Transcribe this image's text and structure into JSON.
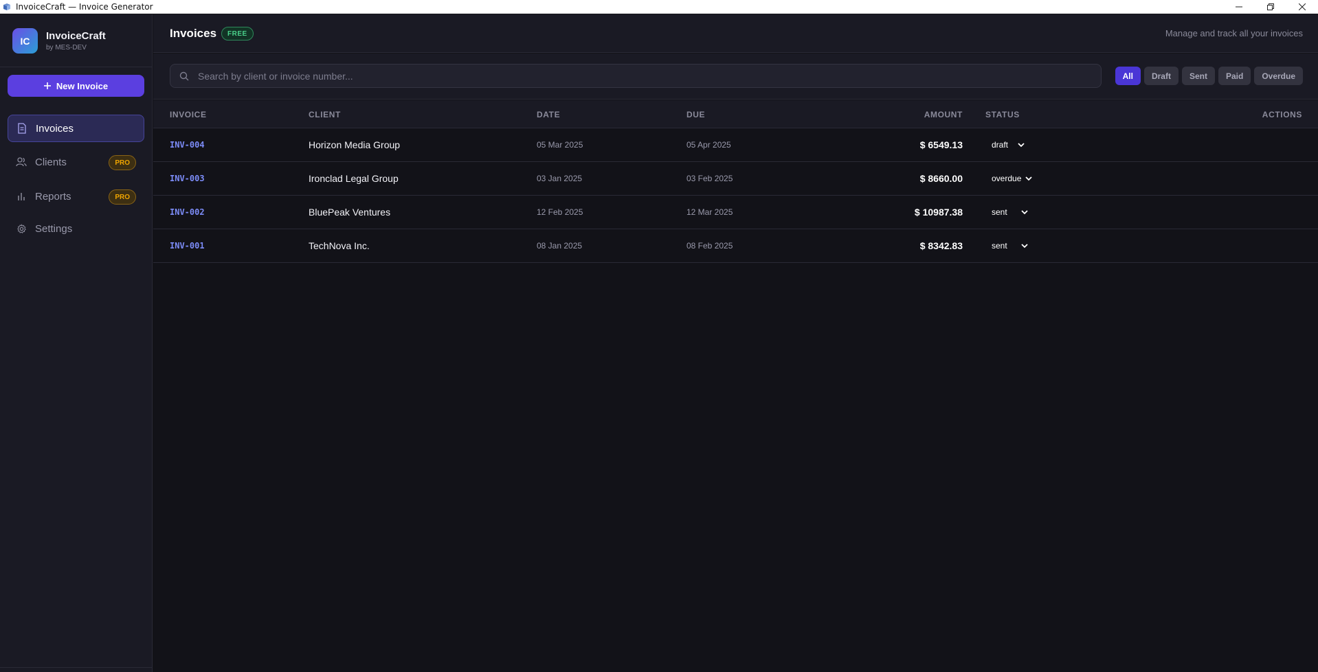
{
  "window": {
    "title": "InvoiceCraft — Invoice Generator"
  },
  "brand": {
    "initials": "IC",
    "name": "InvoiceCraft",
    "by": "by MES-DEV"
  },
  "sidebar": {
    "new_invoice_label": "New Invoice",
    "items": [
      {
        "label": "Invoices",
        "icon": "document-icon",
        "active": true,
        "badge": ""
      },
      {
        "label": "Clients",
        "icon": "users-icon",
        "active": false,
        "badge": "PRO"
      },
      {
        "label": "Reports",
        "icon": "bar-chart-icon",
        "active": false,
        "badge": "PRO"
      },
      {
        "label": "Settings",
        "icon": "gear-icon",
        "active": false,
        "badge": ""
      }
    ]
  },
  "header": {
    "title": "Invoices",
    "plan_badge": "FREE",
    "subtitle": "Manage and track all your invoices"
  },
  "search": {
    "placeholder": "Search by client or invoice number...",
    "value": ""
  },
  "filters": [
    {
      "label": "All",
      "active": true
    },
    {
      "label": "Draft",
      "active": false
    },
    {
      "label": "Sent",
      "active": false
    },
    {
      "label": "Paid",
      "active": false
    },
    {
      "label": "Overdue",
      "active": false
    }
  ],
  "table": {
    "columns": {
      "invoice": "INVOICE",
      "client": "CLIENT",
      "date": "DATE",
      "due": "DUE",
      "amount": "AMOUNT",
      "status": "STATUS",
      "actions": "ACTIONS"
    },
    "rows": [
      {
        "invoice": "INV-004",
        "client": "Horizon Media Group",
        "date": "05 Mar 2025",
        "due": "05 Apr 2025",
        "amount": "$ 6549.13",
        "status": "draft"
      },
      {
        "invoice": "INV-003",
        "client": "Ironclad Legal Group",
        "date": "03 Jan 2025",
        "due": "03 Feb 2025",
        "amount": "$ 8660.00",
        "status": "overdue"
      },
      {
        "invoice": "INV-002",
        "client": "BluePeak Ventures",
        "date": "12 Feb 2025",
        "due": "12 Mar 2025",
        "amount": "$ 10987.38",
        "status": "sent"
      },
      {
        "invoice": "INV-001",
        "client": "TechNova Inc.",
        "date": "08 Jan 2025",
        "due": "08 Feb 2025",
        "amount": "$ 8342.83",
        "status": "sent"
      }
    ]
  },
  "colors": {
    "accent": "#5b3fe0",
    "invoice_link": "#7c8cf8",
    "pro_badge": "#f0a500",
    "free_badge": "#4ad08a"
  }
}
